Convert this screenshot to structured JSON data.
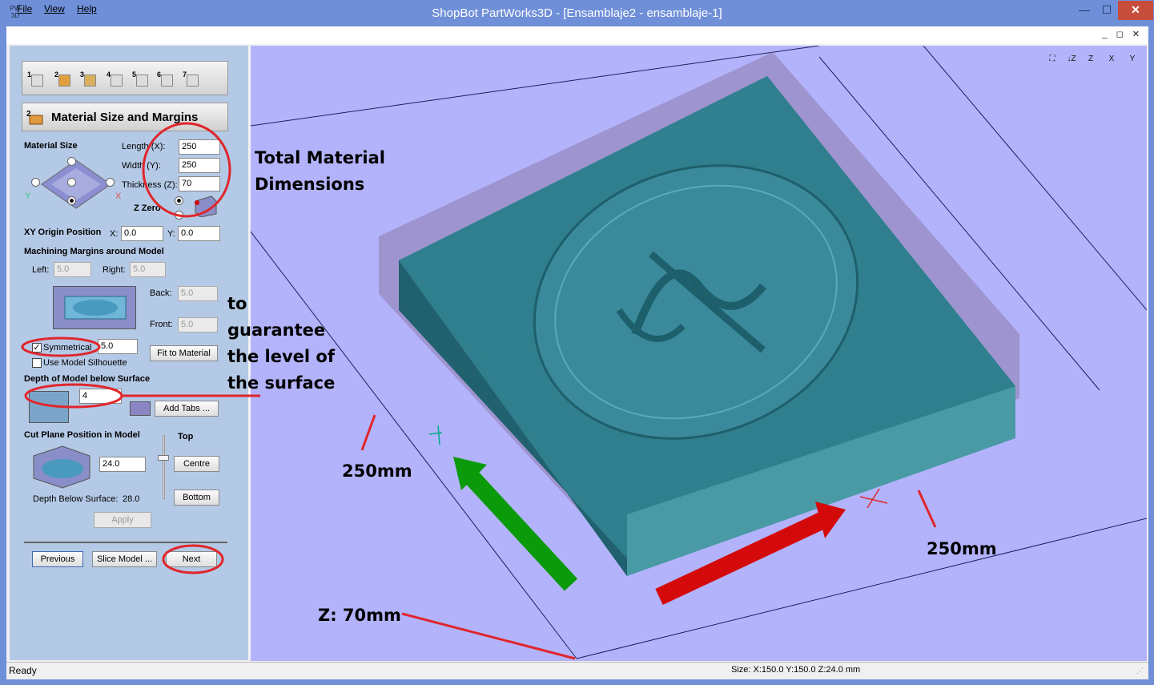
{
  "window": {
    "logo": "PW 3D",
    "title": "ShopBot PartWorks3D - [Ensamblaje2 - ensamblaje-1]",
    "min": "—",
    "max": "☐",
    "close": "✕"
  },
  "menu": {
    "file": "File",
    "view": "View",
    "help": "Help",
    "mdi_controls": "_ ◻ ✕"
  },
  "wizard": {
    "tabs": [
      "1",
      "2",
      "3",
      "4",
      "5",
      "6",
      "7"
    ],
    "step_number": "2",
    "step_title": "Material Size and Margins"
  },
  "material": {
    "section_label": "Material Size",
    "length_label": "Length (X):",
    "length": "250",
    "width_label": "Width (Y):",
    "width": "250",
    "thickness_label": "Thickness (Z):",
    "thickness": "70",
    "zzero_label": "Z Zero",
    "axis_x": "X",
    "axis_y": "Y"
  },
  "origin": {
    "label": "XY Origin Position",
    "x_label": "X:",
    "x": "0.0",
    "y_label": "Y:",
    "y": "0.0"
  },
  "margins": {
    "label": "Machining Margins around Model",
    "left_label": "Left:",
    "left": "5.0",
    "right_label": "Right:",
    "right": "5.0",
    "back_label": "Back:",
    "back": "5.0",
    "front_label": "Front:",
    "front": "5.0",
    "symmetrical_label": "Symmetrical",
    "symmetrical_value": "5.0",
    "fit_button": "Fit to Material",
    "silhouette_label": "Use Model Silhouette"
  },
  "depth": {
    "label": "Depth of Model below Surface",
    "value": "4",
    "add_tabs_button": "Add Tabs ..."
  },
  "cutplane": {
    "label": "Cut Plane Position in Model",
    "value": "24.0",
    "top_label": "Top",
    "centre_button": "Centre",
    "bottom_button": "Bottom",
    "depth_label": "Depth Below Surface:",
    "depth_value": "28.0",
    "apply_button": "Apply"
  },
  "nav": {
    "previous": "Previous",
    "slice": "Slice Model ...",
    "next": "Next"
  },
  "view_tools": [
    "⛶",
    "↓Z",
    "Z",
    "X",
    "Y"
  ],
  "status": {
    "left": "Ready",
    "right": "Size: X:150.0 Y:150.0 Z:24.0 mm"
  },
  "annotations": {
    "total_dims": [
      "Total Material",
      "Dimensions"
    ],
    "guarantee": [
      "to",
      "guarantee",
      "the level of",
      "the surface"
    ],
    "dim_y": "250mm",
    "dim_x": "250mm",
    "dim_z": "Z: 70mm"
  },
  "colors": {
    "accent_red": "#e0262b",
    "viewport_bg": "#b3b3fb",
    "panel_bg": "#b4c9e5",
    "model_teal": "#3a8a9c",
    "arrow_green": "#0a9a0a",
    "arrow_red": "#d40a0a"
  }
}
